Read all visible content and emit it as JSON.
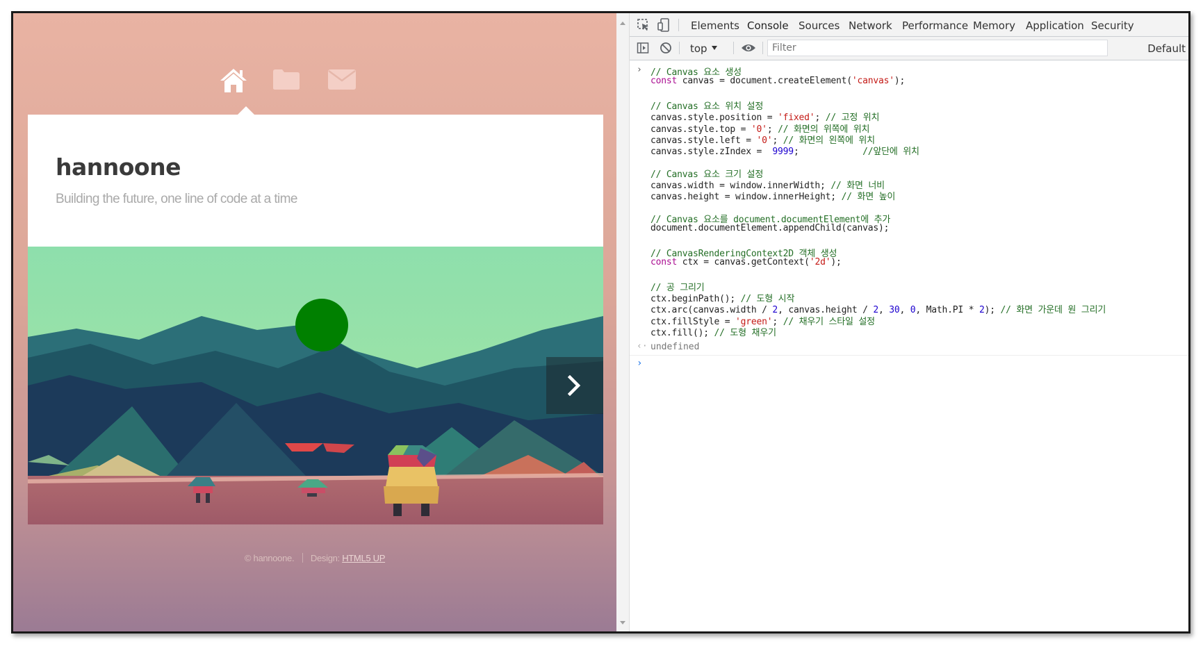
{
  "site": {
    "title": "hannoone",
    "subtitle": "Building the future, one line of code at a time",
    "nav_icons": [
      "home-icon",
      "folder-icon",
      "mail-icon"
    ],
    "footer": {
      "copyright": "© hannoone.",
      "design_label": "Design:",
      "design_link": "HTML5 UP"
    },
    "colors": {
      "background_top": "#e9b3a3",
      "background_bottom": "#9b7b94",
      "ball": "#008000"
    }
  },
  "devtools": {
    "tabs": [
      "Elements",
      "Console",
      "Sources",
      "Network",
      "Performance",
      "Memory",
      "Application",
      "Security"
    ],
    "active_tab": "Console",
    "context": "top",
    "filter_placeholder": "Filter",
    "levels": "Default",
    "code_lines": [
      [
        [
          "c",
          "// Canvas 요소 생성"
        ]
      ],
      [
        [
          "k",
          "const"
        ],
        [
          "t",
          " canvas = document.createElement("
        ],
        [
          "s",
          "'canvas'"
        ],
        [
          "t",
          ");"
        ]
      ],
      [],
      [
        [
          "c",
          "// Canvas 요소 위치 설정"
        ]
      ],
      [
        [
          "t",
          "canvas.style.position = "
        ],
        [
          "s",
          "'fixed'"
        ],
        [
          "t",
          "; "
        ],
        [
          "c",
          "// 고정 위치"
        ]
      ],
      [
        [
          "t",
          "canvas.style.top = "
        ],
        [
          "s",
          "'0'"
        ],
        [
          "t",
          "; "
        ],
        [
          "c",
          "// 화면의 위쪽에 위치"
        ]
      ],
      [
        [
          "t",
          "canvas.style.left = "
        ],
        [
          "s",
          "'0'"
        ],
        [
          "t",
          "; "
        ],
        [
          "c",
          "// 화면의 왼쪽에 위치"
        ]
      ],
      [
        [
          "t",
          "canvas.style.zIndex =  "
        ],
        [
          "n",
          "9999"
        ],
        [
          "t",
          ";            "
        ],
        [
          "c",
          "//앞단에 위치"
        ]
      ],
      [],
      [
        [
          "c",
          "// Canvas 요소 크기 설정"
        ]
      ],
      [
        [
          "t",
          "canvas.width = window.innerWidth; "
        ],
        [
          "c",
          "// 화면 너비"
        ]
      ],
      [
        [
          "t",
          "canvas.height = window.innerHeight; "
        ],
        [
          "c",
          "// 화면 높이"
        ]
      ],
      [],
      [
        [
          "c",
          "// Canvas 요소를 document.documentElement에 추가"
        ]
      ],
      [
        [
          "t",
          "document.documentElement.appendChild(canvas);"
        ]
      ],
      [],
      [
        [
          "c",
          "// CanvasRenderingContext2D 객체 생성"
        ]
      ],
      [
        [
          "k",
          "const"
        ],
        [
          "t",
          " ctx = canvas.getContext("
        ],
        [
          "s",
          "'2d'"
        ],
        [
          "t",
          ");"
        ]
      ],
      [],
      [
        [
          "c",
          "// 공 그리기"
        ]
      ],
      [
        [
          "t",
          "ctx.beginPath(); "
        ],
        [
          "c",
          "// 도형 시작"
        ]
      ],
      [
        [
          "t",
          "ctx.arc(canvas.width / "
        ],
        [
          "n",
          "2"
        ],
        [
          "t",
          ", canvas.height / "
        ],
        [
          "n",
          "2"
        ],
        [
          "t",
          ", "
        ],
        [
          "n",
          "30"
        ],
        [
          "t",
          ", "
        ],
        [
          "n",
          "0"
        ],
        [
          "t",
          ", Math.PI * "
        ],
        [
          "n",
          "2"
        ],
        [
          "t",
          "); "
        ],
        [
          "c",
          "// 화면 가운데 원 그리기"
        ]
      ],
      [
        [
          "t",
          "ctx.fillStyle = "
        ],
        [
          "s",
          "'green'"
        ],
        [
          "t",
          "; "
        ],
        [
          "c",
          "// 채우기 스타일 설정"
        ]
      ],
      [
        [
          "t",
          "ctx.fill(); "
        ],
        [
          "c",
          "// 도형 채우기"
        ]
      ]
    ],
    "result": "undefined"
  }
}
